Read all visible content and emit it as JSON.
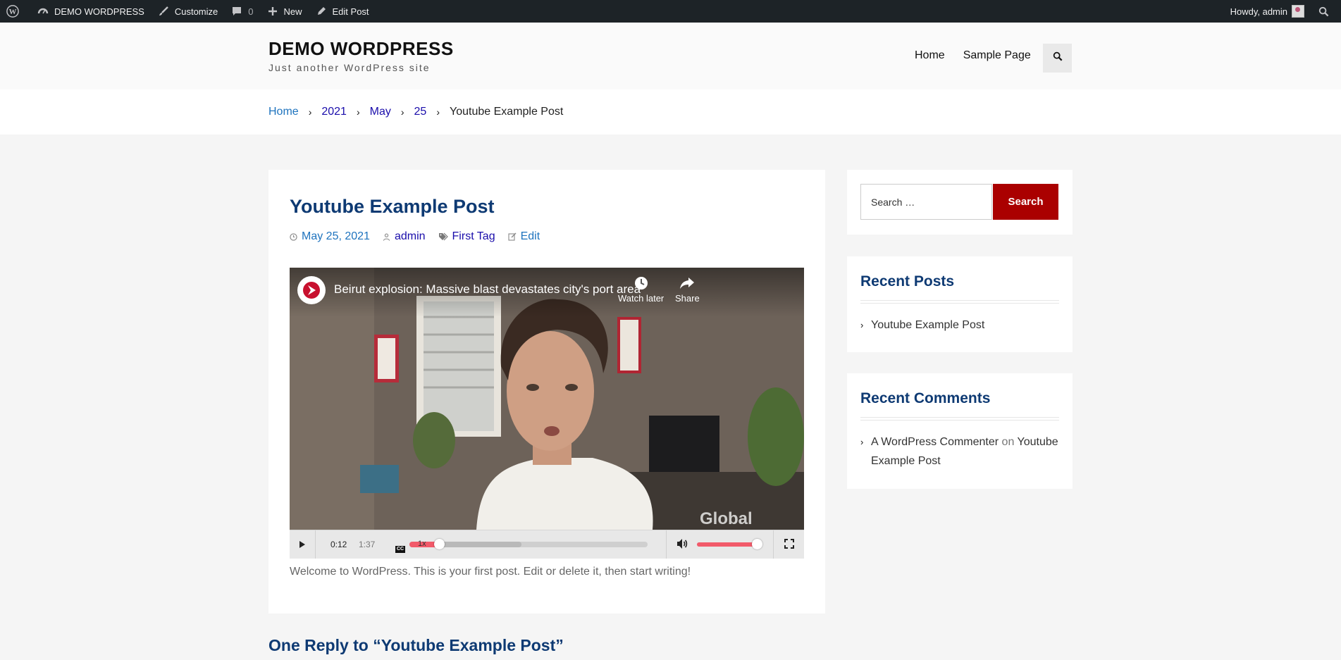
{
  "adminbar": {
    "site_name": "DEMO WORDPRESS",
    "customize": "Customize",
    "comments_count": "0",
    "new": "New",
    "edit_post": "Edit Post",
    "howdy": "Howdy, admin"
  },
  "header": {
    "site_title": "DEMO WORDPRESS",
    "tagline": "Just another WordPress site",
    "nav": [
      "Home",
      "Sample Page"
    ]
  },
  "breadcrumb": {
    "items": [
      "Home",
      "2021",
      "May",
      "25"
    ],
    "current": "Youtube Example Post"
  },
  "post": {
    "title": "Youtube Example Post",
    "date": "May 25, 2021",
    "author": "admin",
    "tag": "First Tag",
    "edit": "Edit",
    "body": "Welcome to WordPress. This is your first post. Edit or delete it, then start writing!"
  },
  "video": {
    "title": "Beirut explosion: Massive blast devastates city's port area",
    "watch_later": "Watch later",
    "share": "Share",
    "watermark": "Global",
    "current_time": "0:12",
    "duration": "1:37",
    "speed": "1x",
    "cc": "CC",
    "progress_fraction": 0.124,
    "buffered_fraction": 0.47,
    "volume_fraction": 0.92
  },
  "comments_heading": "One Reply to “Youtube Example Post”",
  "sidebar": {
    "search_placeholder": "Search …",
    "search_button": "Search",
    "recent_posts_title": "Recent Posts",
    "recent_posts": [
      "Youtube Example Post"
    ],
    "recent_comments_title": "Recent Comments",
    "recent_comment": {
      "author": "A WordPress Commenter",
      "on": "on",
      "post_line1": "Youtube",
      "post_line2": "Example Post"
    }
  },
  "colors": {
    "admin_bar": "#1d2327",
    "title_blue": "#0e3a73",
    "link_blue": "#1e73be",
    "search_button": "#aa0000",
    "player_accent": "#f25a6a"
  }
}
